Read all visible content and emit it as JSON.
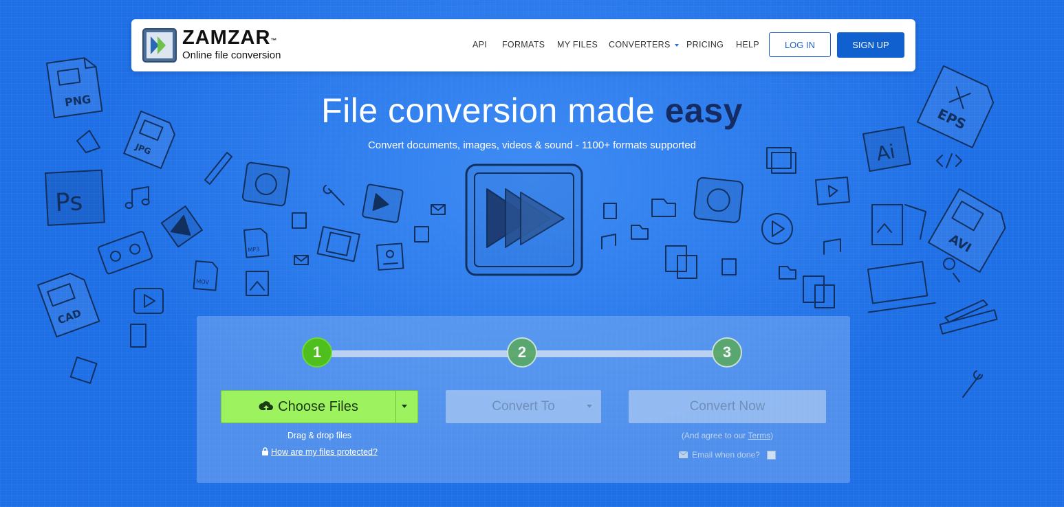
{
  "nav": {
    "brand": "ZAMZAR",
    "trademark": "™",
    "tagline": "Online file conversion",
    "items": [
      {
        "label": "API"
      },
      {
        "label": "FORMATS"
      },
      {
        "label": "MY FILES"
      },
      {
        "label": "CONVERTERS"
      },
      {
        "label": "PRICING"
      },
      {
        "label": "HELP"
      }
    ],
    "login": "LOG IN",
    "signup": "SIGN UP"
  },
  "hero": {
    "title_main": "File conversion made",
    "title_bold": "easy",
    "subtitle": "Convert documents, images, videos & sound - 1100+ formats supported"
  },
  "doodles": {
    "labels": [
      "PNG",
      "JPG",
      "Ps",
      "CAD",
      "MP3",
      "MOV",
      "EPS",
      "Ai",
      "AVI"
    ]
  },
  "converter": {
    "steps": [
      "1",
      "2",
      "3"
    ],
    "choose_files": "Choose Files",
    "convert_to": "Convert To",
    "convert_now": "Convert Now",
    "drag_drop": "Drag & drop files",
    "protected_link": "How are my files protected?",
    "agree_prefix": "(And agree to our ",
    "agree_link": "Terms",
    "agree_suffix": ")",
    "email_label": "Email when done?"
  },
  "colors": {
    "background": "#1f6fe6",
    "accent_green": "#9cf35f",
    "step_active": "#4fbf1d",
    "signup_bg": "#1060d0",
    "title_bold": "#142b63"
  }
}
